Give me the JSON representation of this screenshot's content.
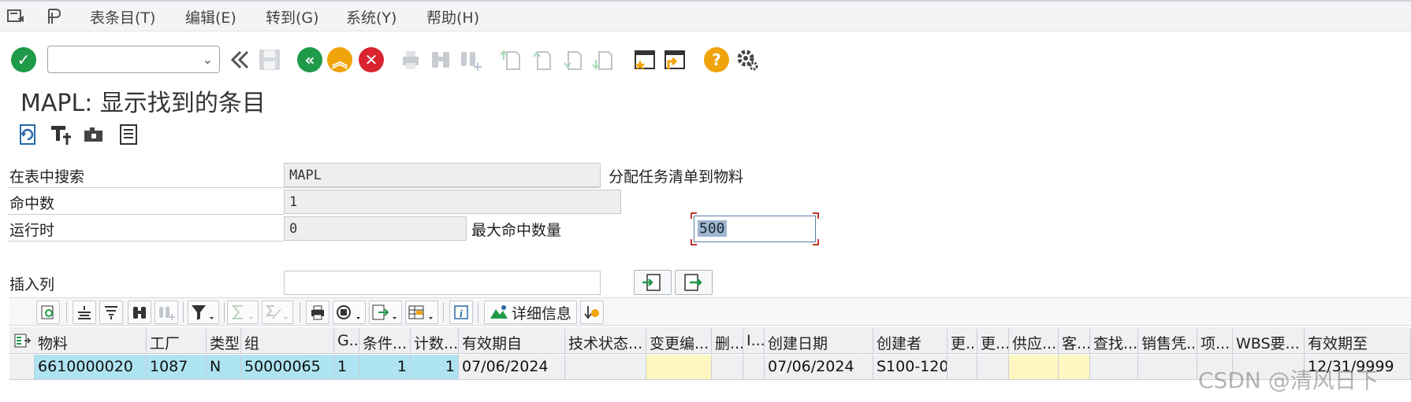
{
  "menu": {
    "items": [
      "表条目(T)",
      "编辑(E)",
      "转到(G)",
      "系统(Y)",
      "帮助(H)"
    ]
  },
  "toolbar": {
    "command_value": "",
    "icons": [
      "enter-check-icon",
      "back-icon",
      "save-icon",
      "green-back-icon",
      "exit-icon",
      "cancel-icon",
      "print-icon",
      "find-icon",
      "find-next-icon",
      "first-page-icon",
      "prev-page-icon",
      "next-page-icon",
      "last-page-icon",
      "create-session-icon",
      "shortcut-icon",
      "help-icon",
      "settings-icon"
    ]
  },
  "page": {
    "title": "MAPL: 显示找到的条目"
  },
  "form": {
    "search_label": "在表中搜索",
    "search_value": "MAPL",
    "search_desc": "分配任务清单到物料",
    "hits_label": "命中数",
    "hits_value": "1",
    "runtime_label": "运行时",
    "runtime_value": "0",
    "maxhits_label": "最大命中数量",
    "maxhits_value": "500",
    "insert_label": "插入列",
    "insert_value": ""
  },
  "alv": {
    "detail_label": "详细信息"
  },
  "grid": {
    "columns": [
      "物料",
      "工厂",
      "类型",
      "组",
      "G...",
      "条件...",
      "计数...",
      "有效期自",
      "技术状态...",
      "变更编...",
      "删...",
      "I...",
      "创建日期",
      "创建者",
      "更...",
      "更...",
      "供应...",
      "客...",
      "查找...",
      "销售凭...",
      "项...",
      "WBS要...",
      "有效期至"
    ],
    "rows": [
      [
        "6610000020",
        "1087",
        "N",
        "50000065",
        "1",
        "1",
        "1",
        "07/06/2024",
        "",
        "",
        "",
        "",
        "07/06/2024",
        "S100-120",
        "",
        "",
        "",
        "",
        "",
        "",
        "",
        "",
        "12/31/9999"
      ]
    ]
  },
  "watermark": "CSDN @清风日下",
  "colors": {
    "accent_green": "#1f9a48",
    "accent_yellow": "#f0a30a",
    "accent_red": "#d9232e",
    "key_cell": "#aee3f1",
    "input_cell": "#fff7c2"
  }
}
